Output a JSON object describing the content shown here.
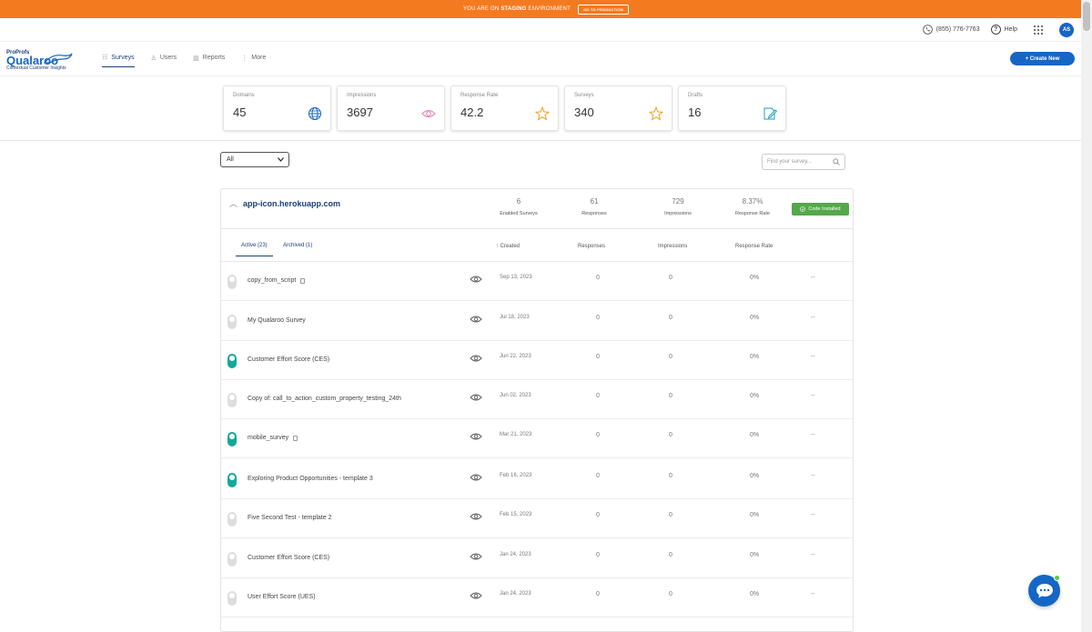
{
  "staging": {
    "prefix": "YOU ARE ON",
    "env": "STAGING",
    "suffix": "ENVIRONMENT",
    "button": "GO TO PRODUCTION"
  },
  "topbar": {
    "phone": "(855) 776-7763",
    "help": "Help",
    "avatar": "AS"
  },
  "logo": {
    "brand_top": "ProProfs",
    "brand": "Qualaroo",
    "tagline": "Contextual Customer Insights"
  },
  "nav": {
    "surveys": "Surveys",
    "users": "Users",
    "reports": "Reports",
    "more": "More",
    "create": "+ Create New"
  },
  "stats": [
    {
      "label": "Domains",
      "value": "45",
      "icon": "globe-icon"
    },
    {
      "label": "Impressions",
      "value": "3697",
      "icon": "eye-icon"
    },
    {
      "label": "Response Rate",
      "value": "42.2",
      "icon": "star-icon"
    },
    {
      "label": "Surveys",
      "value": "340",
      "icon": "star-icon"
    },
    {
      "label": "Drafts",
      "value": "16",
      "icon": "edit-icon"
    }
  ],
  "filter": {
    "value": "All"
  },
  "search": {
    "placeholder": "Find your survey..."
  },
  "domain": {
    "name": "app-icon.herokuapp.com",
    "enabled_surveys": "6",
    "enabled_label": "Enabled Surveys",
    "responses": "61",
    "responses_label": "Responses",
    "impressions": "729",
    "impressions_label": "Impressions",
    "rate": "8.37%",
    "rate_label": "Response Rate",
    "badge": "Code Installed"
  },
  "table": {
    "tab_active": "Active (23)",
    "tab_archived": "Archived (1)",
    "col_created": "↑ Created",
    "col_responses": "Responses",
    "col_impressions": "Impressions",
    "col_rate": "Response Rate"
  },
  "rows": [
    {
      "name": "copy_from_script",
      "date": "Sep 13, 2023",
      "responses": "0",
      "impressions": "0",
      "rate": "0%",
      "extra": "--",
      "active": false,
      "copy": true
    },
    {
      "name": "My Qualaroo Survey",
      "date": "Jul 18, 2023",
      "responses": "0",
      "impressions": "0",
      "rate": "0%",
      "extra": "--",
      "active": false,
      "copy": false
    },
    {
      "name": "Customer Effort Score (CES)",
      "date": "Jun 22, 2023",
      "responses": "0",
      "impressions": "0",
      "rate": "0%",
      "extra": "--",
      "active": true,
      "copy": false
    },
    {
      "name": "Copy of: call_to_action_custom_property_testing_24th",
      "date": "Jun 02, 2023",
      "responses": "0",
      "impressions": "0",
      "rate": "0%",
      "extra": "--",
      "active": false,
      "copy": false
    },
    {
      "name": "mobile_survey",
      "date": "Mar 21, 2023",
      "responses": "0",
      "impressions": "0",
      "rate": "0%",
      "extra": "--",
      "active": true,
      "copy": true
    },
    {
      "name": "Exploring Product Opportunities - template 3",
      "date": "Feb 16, 2023",
      "responses": "0",
      "impressions": "0",
      "rate": "0%",
      "extra": "--",
      "active": true,
      "copy": false
    },
    {
      "name": "Five Second Test - template 2",
      "date": "Feb 15, 2023",
      "responses": "0",
      "impressions": "0",
      "rate": "0%",
      "extra": "--",
      "active": false,
      "copy": false
    },
    {
      "name": "Customer Effort Score (CES)",
      "date": "Jan 24, 2023",
      "responses": "0",
      "impressions": "0",
      "rate": "0%",
      "extra": "--",
      "active": false,
      "copy": false
    },
    {
      "name": "User Effort Score (UES)",
      "date": "Jan 24, 2023",
      "responses": "0",
      "impressions": "0",
      "rate": "0%",
      "extra": "--",
      "active": false,
      "copy": false
    }
  ],
  "colors": {
    "staging": "#f47a20",
    "brand": "#1666c5",
    "toggle_on": "#14a89a",
    "badge": "#55a84a"
  }
}
